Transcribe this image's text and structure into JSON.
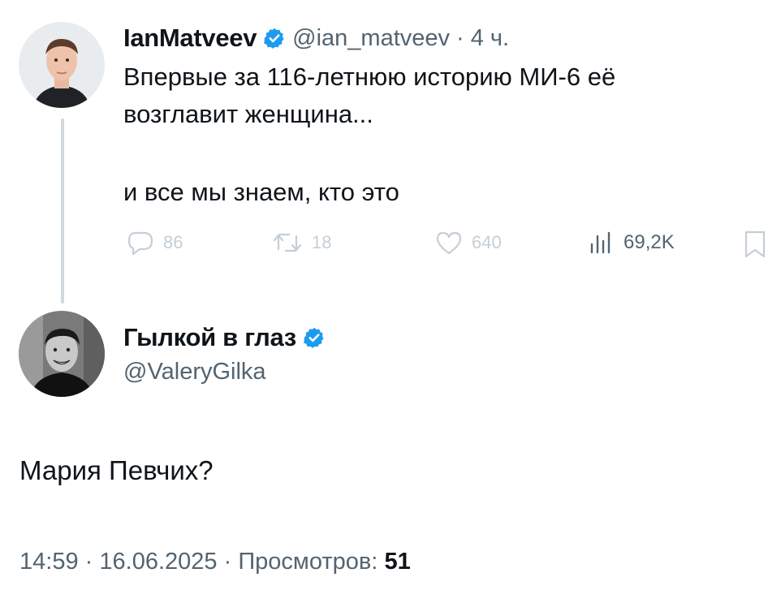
{
  "original_tweet": {
    "display_name": "IanMatveev",
    "handle": "@ian_matveev",
    "separator": "·",
    "time_ago": "4 ч.",
    "text_line1": "Впервые за 116-летнюю историю МИ-6 её",
    "text_line2": "возглавит женщина...",
    "text_line3": "и все мы знаем, кто это",
    "stats": {
      "replies": "86",
      "retweets": "18",
      "likes": "640",
      "views": "69,2K"
    }
  },
  "reply": {
    "display_name": "Гылкой в глаз",
    "handle": "@ValeryGilka",
    "text": "Мария Певчих?",
    "time": "14:59",
    "date": "16.06.2025",
    "views_label": "Просмотров:",
    "views_count": "51",
    "dot": "·"
  },
  "colors": {
    "verified": "#1d9bf0",
    "muted": "#536471",
    "action_gray": "#8b98a5",
    "thread_line": "#cfd9de"
  },
  "icons": [
    "verified-badge-icon",
    "reply-icon",
    "retweet-icon",
    "like-icon",
    "views-icon",
    "bookmark-icon"
  ]
}
